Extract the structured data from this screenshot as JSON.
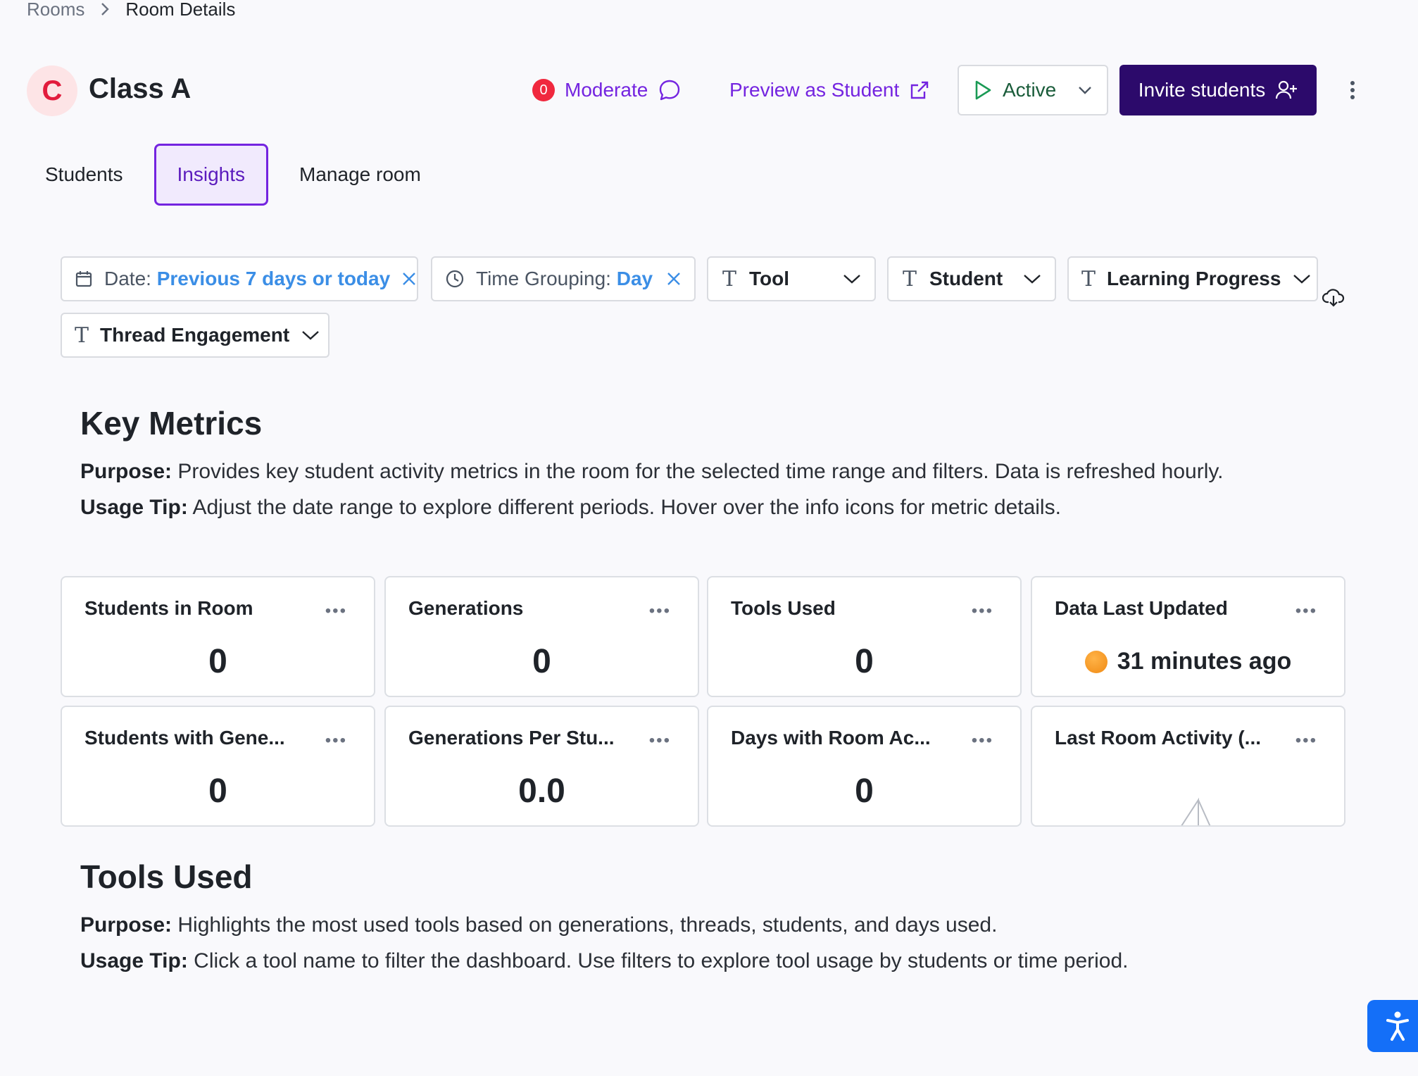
{
  "breadcrumb": {
    "parent": "Rooms",
    "current": "Room Details"
  },
  "room": {
    "avatar_letter": "C",
    "title": "Class A"
  },
  "header": {
    "moderate_count": "0",
    "moderate_label": "Moderate",
    "preview_label": "Preview as Student",
    "status_value": "Active",
    "invite_label": "Invite students"
  },
  "tabs": [
    {
      "label": "Students",
      "active": false
    },
    {
      "label": "Insights",
      "active": true
    },
    {
      "label": "Manage room",
      "active": false
    }
  ],
  "filters": {
    "date_key": "Date:",
    "date_value": "Previous 7 days or today",
    "grouping_key": "Time Grouping:",
    "grouping_value": "Day",
    "tool": "Tool",
    "student": "Student",
    "learning_progress": "Learning Progress",
    "thread_engagement": "Thread Engagement"
  },
  "key_metrics": {
    "title": "Key Metrics",
    "purpose_label": "Purpose:",
    "purpose_text": " Provides key student activity metrics in the room for the selected time range and filters. Data is refreshed hourly.",
    "tip_label": "Usage Tip:",
    "tip_text": " Adjust the date range to explore different periods. Hover over the info icons for metric details."
  },
  "metrics": [
    {
      "title": "Students in Room",
      "value": "0"
    },
    {
      "title": "Generations",
      "value": "0"
    },
    {
      "title": "Tools Used",
      "value": "0"
    },
    {
      "title": "Data Last Updated",
      "value": "31 minutes ago"
    },
    {
      "title": "Students with Gene...",
      "value": "0"
    },
    {
      "title": "Generations Per Stu...",
      "value": "0.0"
    },
    {
      "title": "Days with Room Ac...",
      "value": "0"
    },
    {
      "title": "Last Room Activity (...",
      "value": ""
    }
  ],
  "tools_used": {
    "title": "Tools Used",
    "purpose_label": "Purpose:",
    "purpose_text": " Highlights the most used tools based on generations, threads, students, and days used.",
    "tip_label": "Usage Tip:",
    "tip_text": " Click a tool name to filter the dashboard. Use filters to explore tool usage by students or time period."
  },
  "colors": {
    "accent_purple": "#7424e0",
    "invite_bg": "#2c0a6b",
    "badge_red": "#f0283e",
    "filter_value_blue": "#3b8ee6",
    "status_green": "#1a5c3a",
    "a11y_blue": "#146ff8"
  },
  "icons": [
    "chevron-right-icon",
    "chat-bubble-icon",
    "external-link-icon",
    "play-icon",
    "chevron-down-icon",
    "add-user-icon",
    "kebab-menu-icon",
    "calendar-icon",
    "clock-icon",
    "close-icon",
    "text-field-icon",
    "cloud-download-icon",
    "ellipsis-icon",
    "status-dot-icon",
    "accessibility-icon"
  ]
}
